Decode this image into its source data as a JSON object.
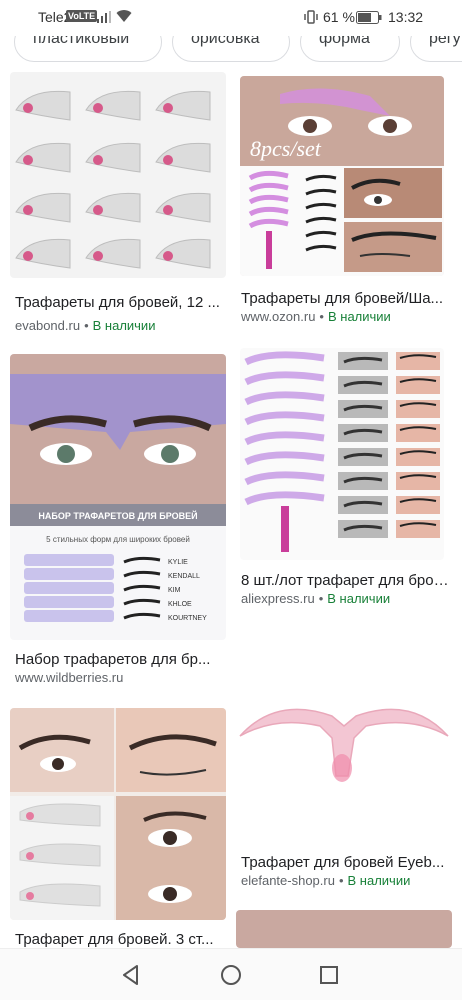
{
  "status": {
    "carrier": "Tele2",
    "volte": "VoLTE",
    "battery_pct": "61 %",
    "time": "13:32"
  },
  "chips": [
    "пластиковый",
    "орисовка",
    "форма",
    "регу"
  ],
  "results": [
    {
      "title": "Трафареты для бровей, 12 ...",
      "domain": "evabond.ru",
      "stock": "В наличии"
    },
    {
      "title": "Трафареты для бровей/Ша...",
      "domain": "www.ozon.ru",
      "stock": "В наличии",
      "overlay": "8pcs/set"
    },
    {
      "title": "Набор трафаретов для бр...",
      "domain": "www.wildberries.ru",
      "banner": "НАБОР ТРАФАРЕТОВ ДЛЯ БРОВЕЙ",
      "subtitle": "5 стильных форм для широких бровей",
      "shapes": [
        "KYLIE",
        "KENDALL",
        "KIM",
        "KHLOE",
        "KOURTNEY"
      ]
    },
    {
      "title": "8 шт./лот трафарет для бров...",
      "domain": "aliexpress.ru",
      "stock": "В наличии"
    },
    {
      "title": "Трафарет для бровей Eyeb...",
      "domain": "elefante-shop.ru",
      "stock": "В наличии"
    },
    {
      "title": "Трафарет для бровей. 3 ст...",
      "domain": ""
    }
  ],
  "nav": {
    "back": "back-icon",
    "home": "home-icon",
    "recents": "recents-icon"
  }
}
